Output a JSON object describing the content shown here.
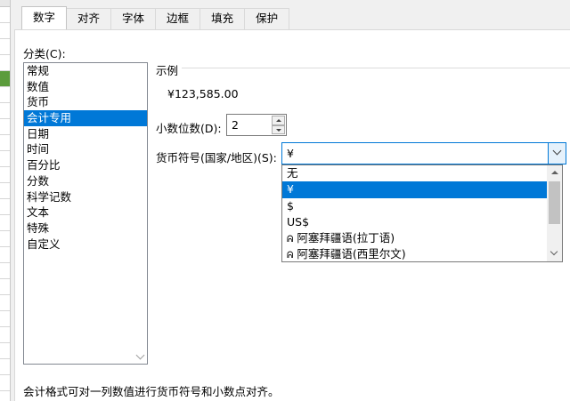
{
  "tabs": [
    {
      "label": "数字",
      "active": true
    },
    {
      "label": "对齐",
      "active": false
    },
    {
      "label": "字体",
      "active": false
    },
    {
      "label": "边框",
      "active": false
    },
    {
      "label": "填充",
      "active": false
    },
    {
      "label": "保护",
      "active": false
    }
  ],
  "category": {
    "label": "分类(C):",
    "items": [
      "常规",
      "数值",
      "货币",
      "会计专用",
      "日期",
      "时间",
      "百分比",
      "分数",
      "科学记数",
      "文本",
      "特殊",
      "自定义"
    ],
    "selected": "会计专用"
  },
  "sample": {
    "label": "示例",
    "value": "¥123,585.00"
  },
  "decimal_places": {
    "label": "小数位数(D):",
    "value": "2"
  },
  "currency_symbol": {
    "label": "货币符号(国家/地区)(S):",
    "value": "¥",
    "options": [
      "无",
      "¥",
      "$",
      "US$",
      "阿塞拜疆语(拉丁语)",
      "阿塞拜疆语(西里尔文)"
    ],
    "selected": "¥",
    "lang_icon": "ᕱ"
  },
  "description": "会计格式可对一列数值进行货币符号和小数点对齐。",
  "colors": {
    "selection": "#0078d7",
    "focus_border": "#0078d7"
  }
}
